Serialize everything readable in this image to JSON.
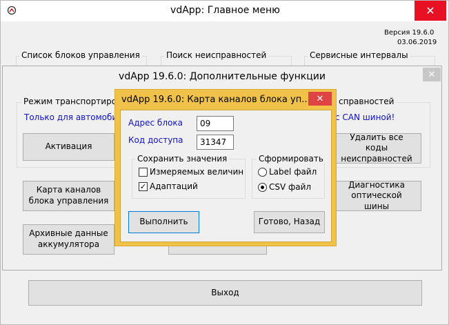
{
  "main_window": {
    "title": "vdApp:  Главное меню",
    "version": "Версия 19.6.0",
    "date": "03.06.2019",
    "groups": [
      "Список блоков управления",
      "Поиск неисправностей",
      "Сервисные интервалы"
    ],
    "exit_label": "Выход"
  },
  "extra_window": {
    "title": "vdApp 19.6.0:  Дополнительные функции",
    "transport_group": "Режим транспортиров",
    "transport_note": "Только для автомобил",
    "activate_label": "Активация",
    "faults_group": "справностей",
    "can_note": "с CAN шиной!",
    "delete_codes_label": "Удалить все коды неисправностей",
    "channel_map_label": "Карта каналов блока управления",
    "bus_diag_label": "Диагностика оптической шины",
    "battery_label": "Архивные данные аккумулятора"
  },
  "dialog": {
    "title": "vdApp 19.6.0:  Карта каналов блока уп...",
    "address_label": "Адрес блока",
    "address_value": "09",
    "access_label": "Код доступа",
    "access_value": "31347",
    "save_group": "Сохранить значения",
    "measured_label": "Измеряемых величин",
    "measured_checked": false,
    "adaptation_label": "Адаптаций",
    "adaptation_checked": true,
    "form_group": "Сформировать",
    "label_file": "Label файл",
    "csv_file": "CSV файл",
    "selected_format": "CSV файл",
    "execute_label": "Выполнить",
    "done_label": "Готово, Назад",
    "check_mark": "✓"
  },
  "icons": {
    "app_icon": "app-icon",
    "close": "close-icon"
  },
  "colors": {
    "close_red": "#e81123",
    "dialog_border": "#f0c24a",
    "accent_text": "#1010c8"
  }
}
